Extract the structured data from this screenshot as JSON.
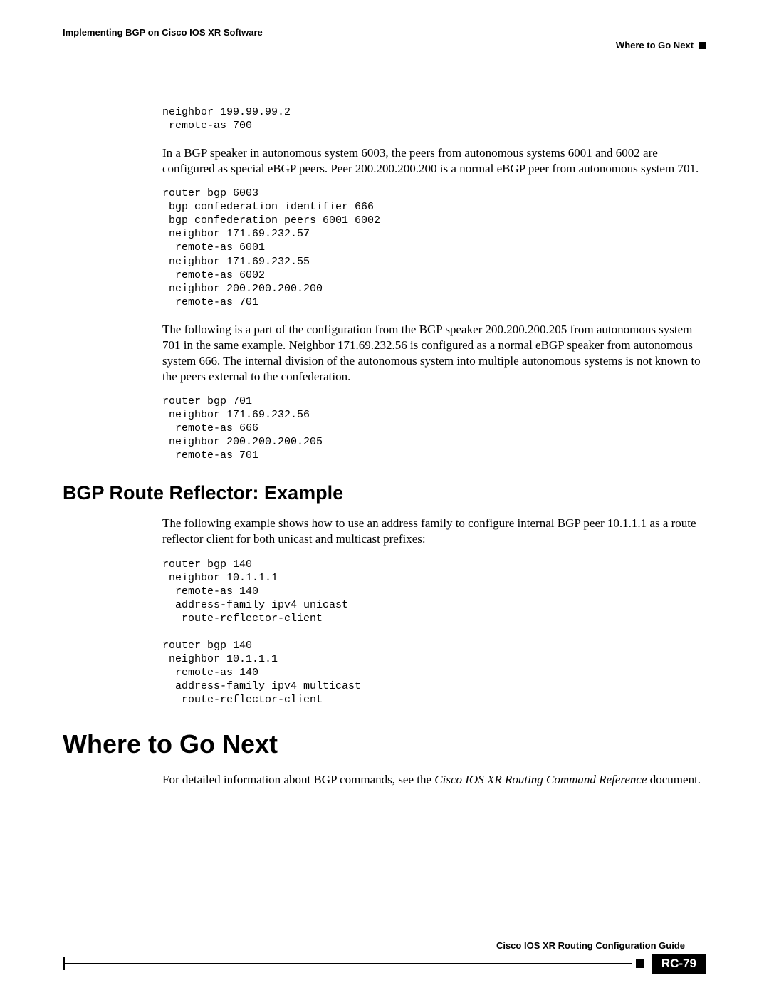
{
  "header": {
    "chapter": "Implementing BGP on Cisco IOS XR Software",
    "topic": "Where to Go Next"
  },
  "body": {
    "code1": "neighbor 199.99.99.2\n remote-as 700",
    "para1": "In a BGP speaker in autonomous system 6003, the peers from autonomous systems 6001 and 6002 are configured as special eBGP peers. Peer 200.200.200.200 is a normal eBGP peer from autonomous system 701.",
    "code2": "router bgp 6003\n bgp confederation identifier 666\n bgp confederation peers 6001 6002\n neighbor 171.69.232.57\n  remote-as 6001\n neighbor 171.69.232.55\n  remote-as 6002\n neighbor 200.200.200.200\n  remote-as 701",
    "para2": "The following is a part of the configuration from the BGP speaker 200.200.200.205 from autonomous system 701 in the same example. Neighbor 171.69.232.56 is configured as a normal eBGP speaker from autonomous system 666. The internal division of the autonomous system into multiple autonomous systems is not known to the peers external to the confederation.",
    "code3": "router bgp 701\n neighbor 171.69.232.56\n  remote-as 666\n neighbor 200.200.200.205\n  remote-as 701",
    "h2": "BGP Route Reflector: Example",
    "para3": "The following example shows how to use an address family to configure internal BGP peer 10.1.1.1 as a route reflector client for both unicast and multicast prefixes:",
    "code4": "router bgp 140\n neighbor 10.1.1.1\n  remote-as 140\n  address-family ipv4 unicast\n   route-reflector-client\n\nrouter bgp 140\n neighbor 10.1.1.1\n  remote-as 140\n  address-family ipv4 multicast\n   route-reflector-client",
    "h1": "Where to Go Next",
    "para4_a": "For detailed information about BGP commands, see the ",
    "para4_i": "Cisco IOS XR Routing Command Reference",
    "para4_b": " document."
  },
  "footer": {
    "guide": "Cisco IOS XR Routing Configuration Guide",
    "page": "RC-79"
  }
}
